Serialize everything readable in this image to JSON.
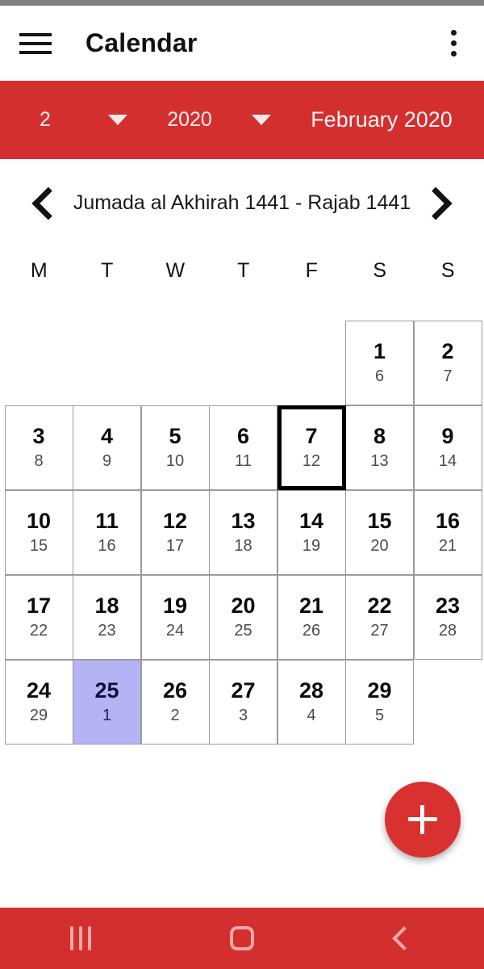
{
  "appbar": {
    "title": "Calendar",
    "menu_icon": "hamburger-menu-icon",
    "overflow_icon": "more-vertical-icon"
  },
  "selector_bar": {
    "month_value": "2",
    "year_value": "2020",
    "gregorian_label": "February 2020",
    "accent_color": "#d32f2f"
  },
  "month_nav": {
    "prev_icon": "chevron-left-icon",
    "next_icon": "chevron-right-icon",
    "hijri_range": "Jumada al Akhirah 1441 - Rajab 1441"
  },
  "weekdays": [
    "M",
    "T",
    "W",
    "T",
    "F",
    "S",
    "S"
  ],
  "calendar": {
    "today_gregorian": "7",
    "selected_gregorian": "25",
    "selected_color": "#b4b4f5",
    "today_border_color": "#000000",
    "weeks": [
      [
        {
          "greg": "",
          "hij": "",
          "blank": true
        },
        {
          "greg": "",
          "hij": "",
          "blank": true
        },
        {
          "greg": "",
          "hij": "",
          "blank": true
        },
        {
          "greg": "",
          "hij": "",
          "blank": true
        },
        {
          "greg": "",
          "hij": "",
          "blank": true
        },
        {
          "greg": "1",
          "hij": "6"
        },
        {
          "greg": "2",
          "hij": "7"
        }
      ],
      [
        {
          "greg": "3",
          "hij": "8"
        },
        {
          "greg": "4",
          "hij": "9"
        },
        {
          "greg": "5",
          "hij": "10"
        },
        {
          "greg": "6",
          "hij": "11"
        },
        {
          "greg": "7",
          "hij": "12",
          "today": true
        },
        {
          "greg": "8",
          "hij": "13"
        },
        {
          "greg": "9",
          "hij": "14"
        }
      ],
      [
        {
          "greg": "10",
          "hij": "15"
        },
        {
          "greg": "11",
          "hij": "16"
        },
        {
          "greg": "12",
          "hij": "17"
        },
        {
          "greg": "13",
          "hij": "18"
        },
        {
          "greg": "14",
          "hij": "19"
        },
        {
          "greg": "15",
          "hij": "20"
        },
        {
          "greg": "16",
          "hij": "21"
        }
      ],
      [
        {
          "greg": "17",
          "hij": "22"
        },
        {
          "greg": "18",
          "hij": "23"
        },
        {
          "greg": "19",
          "hij": "24"
        },
        {
          "greg": "20",
          "hij": "25"
        },
        {
          "greg": "21",
          "hij": "26"
        },
        {
          "greg": "22",
          "hij": "27"
        },
        {
          "greg": "23",
          "hij": "28"
        }
      ],
      [
        {
          "greg": "24",
          "hij": "29"
        },
        {
          "greg": "25",
          "hij": "1",
          "selected": true
        },
        {
          "greg": "26",
          "hij": "2"
        },
        {
          "greg": "27",
          "hij": "3"
        },
        {
          "greg": "28",
          "hij": "4"
        },
        {
          "greg": "29",
          "hij": "5"
        },
        {
          "greg": "",
          "hij": "",
          "blank": true
        }
      ]
    ]
  },
  "fab": {
    "icon": "plus-icon",
    "color": "#d93030"
  },
  "navbar": {
    "recents_icon": "recents-icon",
    "home_icon": "home-icon",
    "back_icon": "back-icon",
    "color": "#d42f2f"
  }
}
